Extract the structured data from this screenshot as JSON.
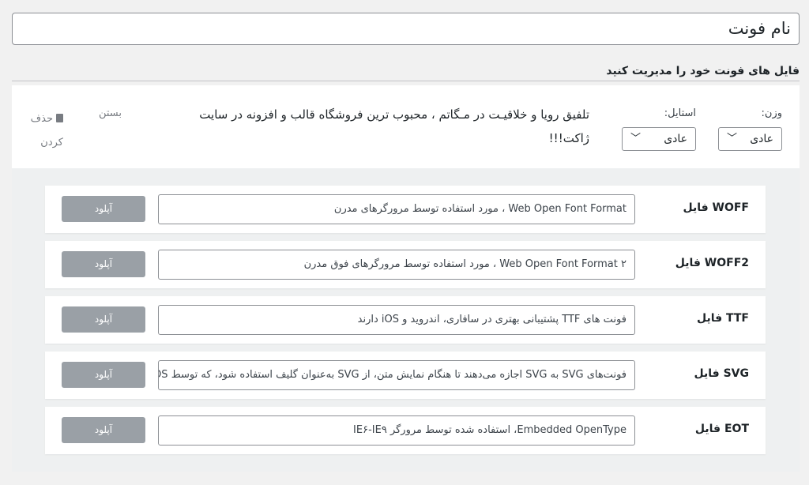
{
  "font_name": "نام فونت",
  "section_title": "فایل های فونت خود را مدیریت کنید",
  "variant": {
    "weight_label": "وزن:",
    "weight_value": "عادی",
    "style_label": "استایل:",
    "style_value": "عادی",
    "preview_text": "تلفیق رویا و خلاقیـت در مـگاتم ، محبوب ترین فروشگاه قالب و افزونه در سایت ژاکت!!!",
    "close_label": "بستن",
    "delete_label": "حذف کردن"
  },
  "files": [
    {
      "label": "WOFF فایل",
      "value": "Web Open Font Format ، مورد استفاده توسط مرورگرهای مدرن",
      "button": "آپلود"
    },
    {
      "label": "WOFF2 فایل",
      "value": "Web Open Font Format ۲ ، مورد استفاده توسط مرورگرهای فوق مدرن",
      "button": "آپلود"
    },
    {
      "label": "TTF فایل",
      "value": "فونت های TTF پشتیبانی بهتری در سافاری، اندروید و iOS دارند",
      "button": "آپلود"
    },
    {
      "label": "SVG فایل",
      "value": "فونت‌های SVG به SVG اجازه می‌دهند تا هنگام نمایش متن، از SVG به‌عنوان گلیف استفاده شود، که توسط iOS قدیمی",
      "button": "آپلود"
    },
    {
      "label": "EOT فایل",
      "value": "Embedded OpenType، استفاده شده توسط مرورگر IE۶-IE۹",
      "button": "آپلود"
    }
  ]
}
